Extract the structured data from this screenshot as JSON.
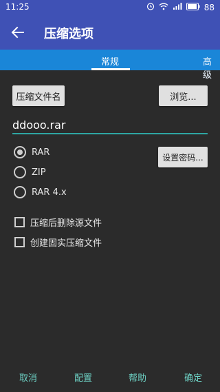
{
  "status": {
    "time": "11:25",
    "battery": "88",
    "icons": [
      "alarm-icon",
      "wifi-icon",
      "signal-icon",
      "battery-icon"
    ]
  },
  "app_bar": {
    "title": "压缩选项",
    "back_icon": "back-arrow-icon"
  },
  "tabs": [
    {
      "label": "常规",
      "active": true
    },
    {
      "label": "高级",
      "active": false
    }
  ],
  "buttons": {
    "archive_name": "压缩文件名",
    "browse": "浏览...",
    "set_password": "设置密码..."
  },
  "filename": {
    "value": "ddooo.rar"
  },
  "formats": [
    {
      "label": "RAR",
      "checked": true
    },
    {
      "label": "ZIP",
      "checked": false
    },
    {
      "label": "RAR 4.x",
      "checked": false
    }
  ],
  "options": [
    {
      "label": "压缩后删除源文件",
      "checked": false
    },
    {
      "label": "创建固实压缩文件",
      "checked": false
    }
  ],
  "footer": {
    "cancel": "取消",
    "profiles": "配置",
    "help": "帮助",
    "ok": "确定"
  },
  "colors": {
    "app_bar": "#3f51b5",
    "tab_bar": "#1a86d8",
    "background": "#2b2b2b",
    "accent": "#2ea6a3",
    "footer_text": "#6ed3c6"
  }
}
